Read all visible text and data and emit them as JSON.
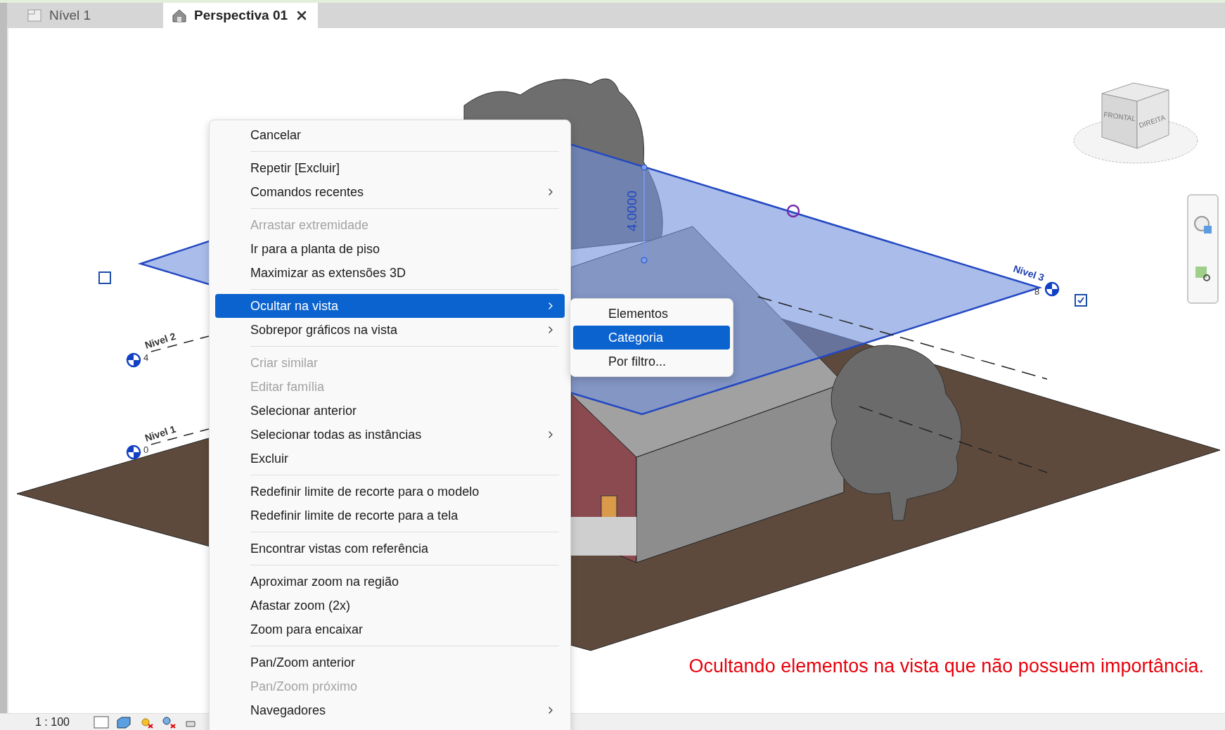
{
  "tabs": [
    {
      "label": "Nível 1",
      "selected": false
    },
    {
      "label": "Perspectiva 01",
      "selected": true
    }
  ],
  "view": {
    "levels": [
      {
        "name": "Nivel 2",
        "elevation": "4"
      },
      {
        "name": "Nivel 1",
        "elevation": "0"
      },
      {
        "name": "Nivel 3",
        "elevation": "8"
      }
    ],
    "dimension": "4.0000",
    "checkboxes": [
      {
        "checked": false
      },
      {
        "checked": true
      }
    ],
    "view_cube": {
      "faces": [
        "FRONTAL",
        "DIREITA"
      ]
    },
    "annotation": "Ocultando elementos na vista que não possuem importância."
  },
  "context_menu": {
    "items": [
      {
        "kind": "item",
        "label": "Cancelar",
        "disabled": false,
        "submenu": false,
        "selected": false
      },
      {
        "kind": "separator"
      },
      {
        "kind": "item",
        "label": "Repetir [Excluir]",
        "disabled": false,
        "submenu": false,
        "selected": false
      },
      {
        "kind": "item",
        "label": "Comandos recentes",
        "disabled": false,
        "submenu": true,
        "selected": false
      },
      {
        "kind": "separator"
      },
      {
        "kind": "item",
        "label": "Arrastar extremidade",
        "disabled": true,
        "submenu": false,
        "selected": false
      },
      {
        "kind": "item",
        "label": "Ir para a planta de piso",
        "disabled": false,
        "submenu": false,
        "selected": false
      },
      {
        "kind": "item",
        "label": "Maximizar as extensões 3D",
        "disabled": false,
        "submenu": false,
        "selected": false
      },
      {
        "kind": "separator"
      },
      {
        "kind": "item",
        "label": "Ocultar na vista",
        "disabled": false,
        "submenu": true,
        "selected": true
      },
      {
        "kind": "item",
        "label": "Sobrepor gráficos na vista",
        "disabled": false,
        "submenu": true,
        "selected": false
      },
      {
        "kind": "separator"
      },
      {
        "kind": "item",
        "label": "Criar similar",
        "disabled": true,
        "submenu": false,
        "selected": false
      },
      {
        "kind": "item",
        "label": "Editar família",
        "disabled": true,
        "submenu": false,
        "selected": false
      },
      {
        "kind": "item",
        "label": "Selecionar anterior",
        "disabled": false,
        "submenu": false,
        "selected": false
      },
      {
        "kind": "item",
        "label": "Selecionar todas as instâncias",
        "disabled": false,
        "submenu": true,
        "selected": false
      },
      {
        "kind": "item",
        "label": "Excluir",
        "disabled": false,
        "submenu": false,
        "selected": false
      },
      {
        "kind": "separator"
      },
      {
        "kind": "item",
        "label": "Redefinir limite de recorte para o modelo",
        "disabled": false,
        "submenu": false,
        "selected": false
      },
      {
        "kind": "item",
        "label": "Redefinir limite de recorte para a tela",
        "disabled": false,
        "submenu": false,
        "selected": false
      },
      {
        "kind": "separator"
      },
      {
        "kind": "item",
        "label": "Encontrar vistas com referência",
        "disabled": false,
        "submenu": false,
        "selected": false
      },
      {
        "kind": "separator"
      },
      {
        "kind": "item",
        "label": "Aproximar zoom na região",
        "disabled": false,
        "submenu": false,
        "selected": false
      },
      {
        "kind": "item",
        "label": "Afastar zoom (2x)",
        "disabled": false,
        "submenu": false,
        "selected": false
      },
      {
        "kind": "item",
        "label": "Zoom para encaixar",
        "disabled": false,
        "submenu": false,
        "selected": false
      },
      {
        "kind": "separator"
      },
      {
        "kind": "item",
        "label": "Pan/Zoom anterior",
        "disabled": false,
        "submenu": false,
        "selected": false
      },
      {
        "kind": "item",
        "label": "Pan/Zoom próximo",
        "disabled": true,
        "submenu": false,
        "selected": false
      },
      {
        "kind": "item",
        "label": "Navegadores",
        "disabled": false,
        "submenu": true,
        "selected": false
      }
    ]
  },
  "submenu": {
    "items": [
      {
        "label": "Elementos",
        "selected": false
      },
      {
        "label": "Categoria",
        "selected": true
      },
      {
        "label": "Por filtro...",
        "selected": false
      }
    ]
  },
  "status_bar": {
    "scale": "1 : 100"
  }
}
